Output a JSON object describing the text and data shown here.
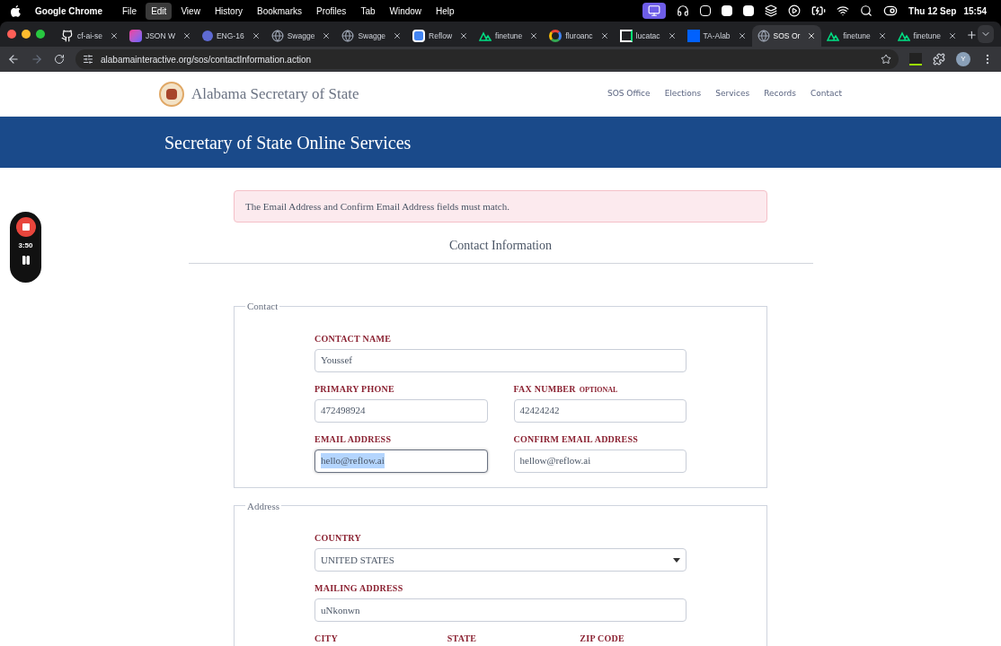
{
  "menu_bar": {
    "app": "Google Chrome",
    "items": [
      {
        "label": "File",
        "selected": false
      },
      {
        "label": "Edit",
        "selected": true
      },
      {
        "label": "View",
        "selected": false
      },
      {
        "label": "History",
        "selected": false
      },
      {
        "label": "Bookmarks",
        "selected": false
      },
      {
        "label": "Profiles",
        "selected": false
      },
      {
        "label": "Tab",
        "selected": false
      },
      {
        "label": "Window",
        "selected": false
      },
      {
        "label": "Help",
        "selected": false
      }
    ],
    "date": "Thu 12 Sep",
    "time": "15:54"
  },
  "tabs": [
    {
      "title": "cf-ai-se",
      "kind": "github",
      "selected": false
    },
    {
      "title": "JSON W",
      "kind": "json",
      "selected": false
    },
    {
      "title": "ENG-16",
      "kind": "linear",
      "selected": false
    },
    {
      "title": "Swagge",
      "kind": "globe",
      "selected": false
    },
    {
      "title": "Swagge",
      "kind": "globe",
      "selected": false
    },
    {
      "title": "Reflow",
      "kind": "calendar",
      "selected": false
    },
    {
      "title": "finetune",
      "kind": "nuxt",
      "selected": false
    },
    {
      "title": "fluroanc",
      "kind": "google",
      "selected": false
    },
    {
      "title": "lucatac",
      "kind": "doc",
      "selected": false
    },
    {
      "title": "TA-Alab",
      "kind": "dropbox",
      "selected": false
    },
    {
      "title": "SOS Or",
      "kind": "globe",
      "selected": true
    },
    {
      "title": "finetune",
      "kind": "nuxt",
      "selected": false
    },
    {
      "title": "finetune",
      "kind": "nuxt",
      "selected": false
    }
  ],
  "address_bar": {
    "url": "alabamainteractive.org/sos/contactInformation.action",
    "profile": "Y"
  },
  "recorder": {
    "elapsed": "3:50"
  },
  "site_header": {
    "title": "Alabama Secretary of State",
    "nav": [
      "SOS Office",
      "Elections",
      "Services",
      "Records",
      "Contact"
    ]
  },
  "banner": {
    "title": "Secretary of State Online Services"
  },
  "alert": {
    "message": "The Email Address and Confirm Email Address fields must match."
  },
  "section_title": "Contact Information",
  "fieldsets": [
    {
      "legend": "Contact",
      "rows": [
        [
          {
            "label": "CONTACT NAME",
            "value": "Youssef",
            "kind": "text",
            "focused": false
          }
        ],
        [
          {
            "label": "PRIMARY PHONE",
            "value": "472498924",
            "kind": "text",
            "focused": false
          },
          {
            "label": "FAX NUMBER",
            "optional": "OPTIONAL",
            "value": "42424242",
            "kind": "text",
            "focused": false
          }
        ],
        [
          {
            "label": "EMAIL ADDRESS",
            "value": "hello@reflow.ai",
            "kind": "text",
            "focused": true
          },
          {
            "label": "CONFIRM EMAIL ADDRESS",
            "value": "hellow@reflow.ai",
            "kind": "text",
            "focused": false
          }
        ]
      ]
    },
    {
      "legend": "Address",
      "rows": [
        [
          {
            "label": "COUNTRY",
            "value": "UNITED STATES",
            "kind": "select",
            "focused": false
          }
        ],
        [
          {
            "label": "MAILING ADDRESS",
            "value": "uNkonwn",
            "kind": "text",
            "focused": false
          }
        ],
        [
          {
            "label": "CITY",
            "kind": "label"
          },
          {
            "label": "STATE",
            "kind": "label"
          },
          {
            "label": "ZIP CODE",
            "kind": "label"
          }
        ]
      ]
    }
  ]
}
